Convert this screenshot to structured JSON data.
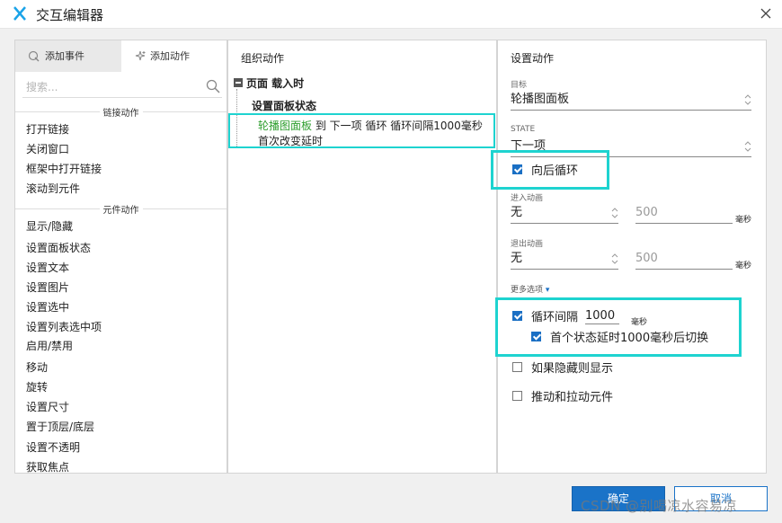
{
  "window": {
    "title": "交互编辑器",
    "icons": {
      "logo": "axure-x-logo",
      "close": "close-icon"
    },
    "accent_color": "#1ed3d0"
  },
  "left_panel": {
    "tabs": [
      {
        "label": "添加事件",
        "icon": "add-event-icon",
        "active": true
      },
      {
        "label": "添加动作",
        "icon": "add-action-icon",
        "active": false
      }
    ],
    "search": {
      "placeholder": "搜索...",
      "value": ""
    },
    "groups": [
      {
        "header": "链接动作",
        "items": [
          "打开链接",
          "关闭窗口",
          "框架中打开链接",
          "滚动到元件"
        ]
      },
      {
        "header": "元件动作",
        "items": [
          "显示/隐藏",
          "设置面板状态",
          "设置文本",
          "设置图片",
          "设置选中",
          "设置列表选中项",
          "启用/禁用",
          "移动",
          "旋转",
          "设置尺寸",
          "置于顶层/底层",
          "设置不透明",
          "获取焦点"
        ]
      }
    ]
  },
  "middle_panel": {
    "title": "组织动作",
    "event": "页面 载入时",
    "case": "设置面板状态",
    "action": {
      "target": "轮播图面板",
      "rest_line1": " 到 下一项 循环 循环间隔1000毫秒",
      "line2": "首次改变延时"
    }
  },
  "right_panel": {
    "title": "设置动作",
    "target_label": "目标",
    "target_value": "轮播图面板",
    "state_label": "STATE",
    "state_value": "下一项",
    "wrap_label": "向后循环",
    "wrap_checked": true,
    "enter_anim_label": "进入动画",
    "enter_anim_value": "无",
    "enter_anim_ms": "500",
    "exit_anim_label": "退出动画",
    "exit_anim_value": "无",
    "exit_anim_ms": "500",
    "ms_unit": "毫秒",
    "more_options": "更多选项",
    "loop_label": "循环间隔",
    "loop_value": "1000",
    "loop_checked": true,
    "first_delay_label": "首个状态延时1000毫秒后切换",
    "first_delay_checked": true,
    "show_if_hidden_label": "如果隐藏则显示",
    "show_if_hidden_checked": false,
    "push_pull_label": "推动和拉动元件",
    "push_pull_checked": false
  },
  "footer": {
    "ok": "确定",
    "cancel": "取消",
    "watermark": "CSDN @别喝凉水容易凉"
  }
}
